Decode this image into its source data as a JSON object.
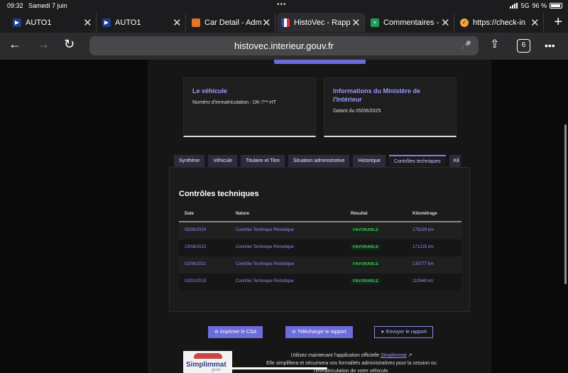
{
  "status_bar": {
    "time": "09:32",
    "date": "Samedi 7 juin",
    "network": "5G",
    "battery": "96 %"
  },
  "browser_tabs": [
    {
      "title": "AUTO1",
      "icon": "auto1-icon",
      "color": "#1f3c88",
      "active": false
    },
    {
      "title": "AUTO1",
      "icon": "auto1-icon",
      "color": "#1f3c88",
      "active": false
    },
    {
      "title": "Car Detail - Adm",
      "icon": "grid-icon",
      "color": "#e3752b",
      "active": false
    },
    {
      "title": "HistoVec - Rapp",
      "icon": "french-flag-icon",
      "color": "#ffffff",
      "active": true
    },
    {
      "title": "Commentaires -",
      "icon": "plus-icon",
      "color": "#1e9d55",
      "active": false
    },
    {
      "title": "https://check-in",
      "icon": "check-icon",
      "color": "#f2a33a",
      "active": false
    }
  ],
  "toolbar": {
    "url": "histovec.interieur.gouv.fr",
    "tab_count": "6"
  },
  "cards": [
    {
      "title": "Le véhicule",
      "text": "Numéro d'immatriculation : DK-7**-HT"
    },
    {
      "title": "Informations du Ministère de l'Intérieur",
      "text": "Datant du 05/06/2025"
    }
  ],
  "report_tabs": [
    {
      "label": "Synthèse",
      "active": false
    },
    {
      "label": "Véhicule",
      "active": false
    },
    {
      "label": "Titulaire et Titre",
      "active": false
    },
    {
      "label": "Situation administrative",
      "active": false
    },
    {
      "label": "Historique",
      "active": false
    },
    {
      "label": "Contrôles techniques",
      "active": true
    },
    {
      "label": "Kil",
      "active": false
    }
  ],
  "controles": {
    "title": "Contrôles techniques",
    "headers": {
      "date": "Date",
      "nature": "Nature",
      "resultat": "Résultat",
      "km": "Kilométrage"
    },
    "rows": [
      {
        "date": "05/06/2024",
        "nature": "Contrôle Technique Périodique",
        "resultat": "FAVORABLE",
        "km": "179229 km"
      },
      {
        "date": "23/08/2023",
        "nature": "Contrôle Technique Périodique",
        "resultat": "FAVORABLE",
        "km": "171225 km"
      },
      {
        "date": "02/08/2021",
        "nature": "Contrôle Technique Périodique",
        "resultat": "FAVORABLE",
        "km": "130777 km"
      },
      {
        "date": "02/01/2019",
        "nature": "Contrôle Technique Périodique",
        "resultat": "FAVORABLE",
        "km": "110948 km"
      }
    ]
  },
  "actions": {
    "print": "Imprimer le CSA",
    "download": "Télécharger le rapport",
    "send": "Envoyer le rapport"
  },
  "promo": {
    "logo_text": "Simplimmat",
    "logo_sub": "gouv",
    "line1_pre": "Utilisez maintenant l'application officielle",
    "line1_link": "Simplimmat",
    "line2": "Elle simplifiera et sécurisera vos formalités administratives pour la cession ou",
    "line3": "l'immatriculation de votre véhicule."
  }
}
